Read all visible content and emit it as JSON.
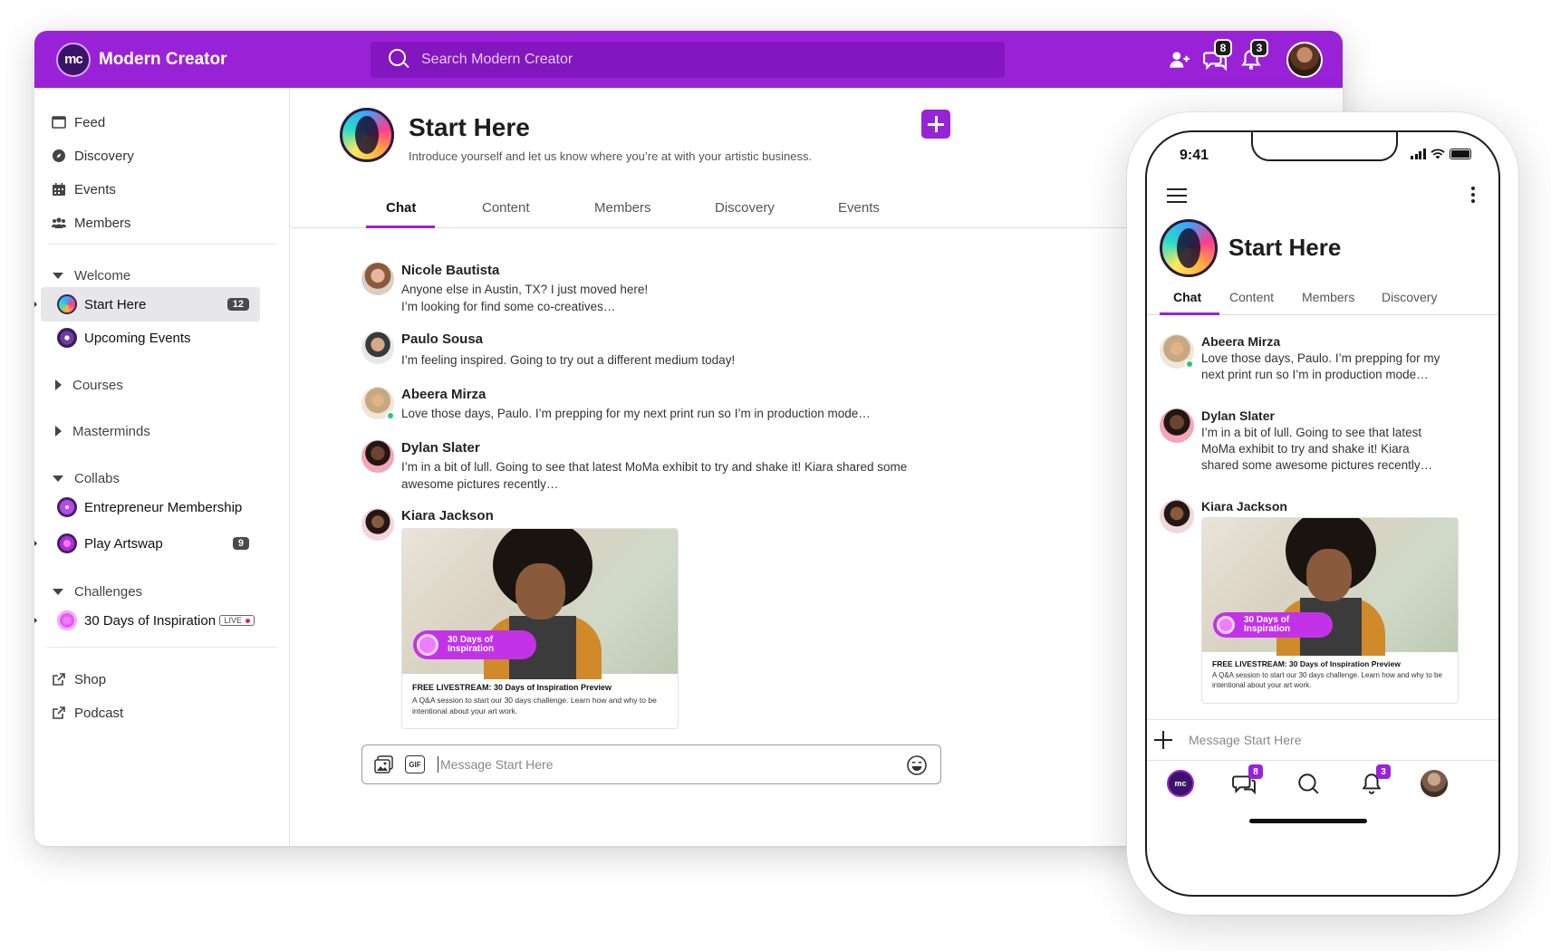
{
  "brand": {
    "logo_text": "mc",
    "name": "Modern Creator"
  },
  "search": {
    "placeholder": "Search Modern Creator"
  },
  "top_bar": {
    "messages_count": "8",
    "notifications_count": "3"
  },
  "sidebar": {
    "nav": [
      {
        "label": "Feed",
        "icon": "feed-icon"
      },
      {
        "label": "Discovery",
        "icon": "compass-icon"
      },
      {
        "label": "Events",
        "icon": "calendar-icon"
      },
      {
        "label": "Members",
        "icon": "users-icon"
      }
    ],
    "sections": {
      "welcome": "Welcome",
      "courses": "Courses",
      "masterminds": "Masterminds",
      "collabs": "Collabs",
      "challenges": "Challenges"
    },
    "channels": {
      "start_here": {
        "label": "Start Here",
        "badge": "12"
      },
      "upcoming_events": {
        "label": "Upcoming Events"
      },
      "entrepreneur_membership": {
        "label": "Entrepreneur Membership"
      },
      "play_artswap": {
        "label": "Play Artswap",
        "badge": "9"
      },
      "thirty_days": {
        "label": "30 Days of Inspiration",
        "live": "LIVE"
      }
    },
    "links": [
      {
        "label": "Shop",
        "icon": "external-link-icon"
      },
      {
        "label": "Podcast",
        "icon": "external-link-icon"
      }
    ]
  },
  "channel": {
    "title": "Start Here",
    "description": "Introduce yourself and let us know where you’re at with your artistic business.",
    "tabs": [
      "Chat",
      "Content",
      "Members",
      "Discovery",
      "Events"
    ],
    "active_tab": "Chat"
  },
  "messages": [
    {
      "name": "Nicole Bautista",
      "lines": [
        "Anyone else in Austin, TX? I just moved here!",
        "I’m looking for find some co-creatives…"
      ]
    },
    {
      "name": "Paulo Sousa",
      "lines": [
        "I’m feeling inspired. Going to try out a different medium today!"
      ]
    },
    {
      "name": "Abeera Mirza",
      "lines": [
        "Love those days, Paulo. I’m prepping for my next print run so I’m in production mode…"
      ],
      "online": true
    },
    {
      "name": "Dylan Slater",
      "lines": [
        "I’m in a bit of lull. Going to see that latest MoMa exhibit to try and shake it! Kiara shared some",
        "awesome pictures recently…"
      ]
    },
    {
      "name": "Kiara Jackson",
      "lines": []
    }
  ],
  "card": {
    "pill_text": "30 Days of Inspiration",
    "title": "FREE LIVESTREAM: 30 Days of Inspiration Preview",
    "description": "A Q&A session to start our 30 days challenge. Learn how and why to be intentional about your art work."
  },
  "composer": {
    "placeholder": "Message Start Here",
    "gif_label": "GIF"
  },
  "phone": {
    "time": "9:41",
    "title": "Start Here",
    "tabs": [
      "Chat",
      "Content",
      "Members",
      "Discovery"
    ],
    "messages": [
      {
        "name": "Abeera Mirza",
        "lines": [
          "Love those days, Paulo. I’m prepping for my",
          "next print run so I’m in production mode…"
        ]
      },
      {
        "name": "Dylan Slater",
        "lines": [
          "I’m in a bit of lull. Going to see that latest",
          "MoMa exhibit to try and shake it! Kiara",
          "shared some awesome pictures recently…"
        ]
      },
      {
        "name": "Kiara Jackson"
      }
    ],
    "composer_placeholder": "Message Start Here",
    "bottom_nav": {
      "logo_text": "mc",
      "messages_badge": "8",
      "notifications_badge": "3"
    }
  },
  "colors": {
    "brand": "#9a22d6",
    "brand_dark": "#8216bf",
    "online": "#28c76f"
  }
}
